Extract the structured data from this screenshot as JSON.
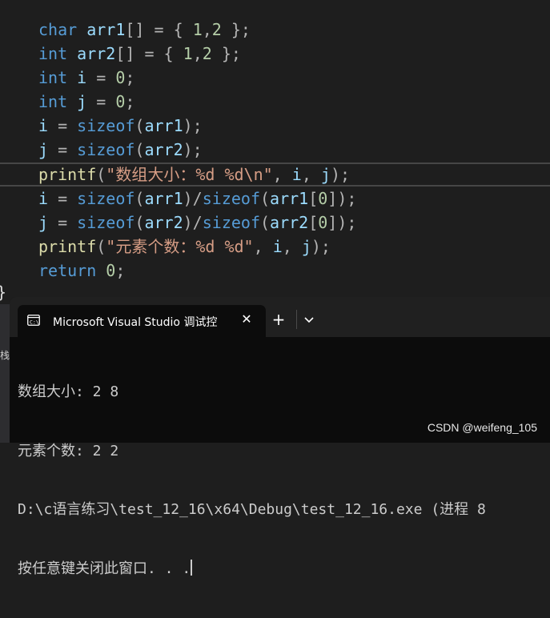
{
  "editor": {
    "code_lines": [
      "char arr1[] = { 1,2 };",
      "int arr2[] = { 1,2 };",
      "int i = 0;",
      "int j = 0;",
      "i = sizeof(arr1);",
      "j = sizeof(arr2);",
      "printf(\"数组大小：%d %d\\n\", i, j);",
      "i = sizeof(arr1)/sizeof(arr1[0]);",
      "j = sizeof(arr2)/sizeof(arr2[0]);",
      "printf(\"元素个数：%d %d\", i, j);",
      "return 0;"
    ],
    "closing_brace": "}"
  },
  "side_panel": {
    "fragment": "栈"
  },
  "terminal": {
    "tab_title": "Microsoft Visual Studio 调试控",
    "close_glyph": "✕",
    "new_tab_glyph": "+",
    "output_lines": [
      "数组大小: 2 8",
      "元素个数: 2 2",
      "D:\\c语言练习\\test_12_16\\x64\\Debug\\test_12_16.exe (进程 8",
      "按任意键关闭此窗口. . ."
    ]
  },
  "watermark": "CSDN @weifeng_105",
  "colors": {
    "keyword": "#569cd6",
    "variable": "#9cdcfe",
    "number": "#b5cea8",
    "function": "#dcdcaa",
    "string": "#d69d85",
    "editor_bg": "#1e1e1e",
    "terminal_bg": "#0c0c0c"
  },
  "icons": {
    "tab_icon": "console-icon",
    "dropdown": "chevron-down-icon"
  }
}
